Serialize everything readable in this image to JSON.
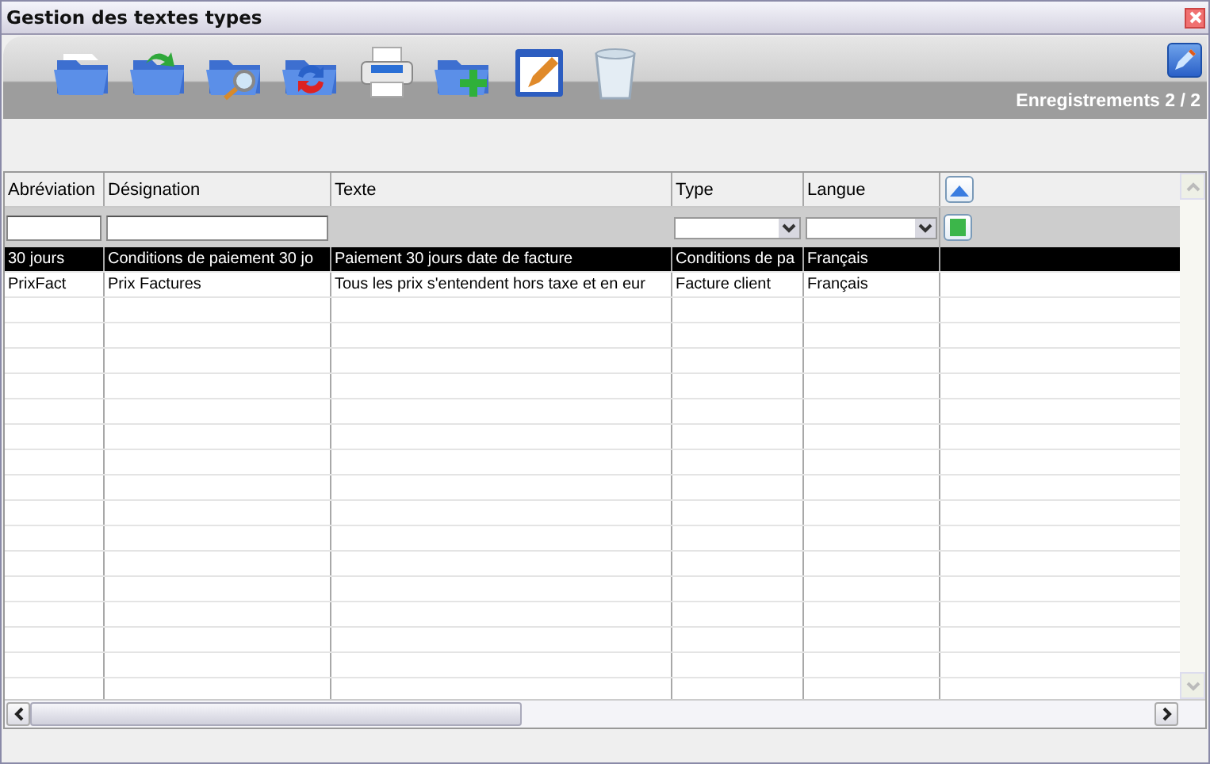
{
  "window": {
    "title": "Gestion des textes types"
  },
  "toolbar": {
    "buttons": [
      {
        "kind": "open"
      },
      {
        "kind": "import"
      },
      {
        "kind": "search"
      },
      {
        "kind": "refresh"
      },
      {
        "kind": "print"
      },
      {
        "kind": "add"
      },
      {
        "kind": "edit"
      },
      {
        "kind": "delete"
      }
    ]
  },
  "record_count": "Enregistrements 2 / 2",
  "table": {
    "columns": [
      {
        "label": "Abréviation"
      },
      {
        "label": "Désignation"
      },
      {
        "label": "Texte"
      },
      {
        "label": "Type"
      },
      {
        "label": "Langue"
      }
    ],
    "filters": [
      {
        "kind": "text"
      },
      {
        "kind": "text"
      },
      {
        "kind": "none"
      },
      {
        "kind": "select"
      },
      {
        "kind": "select"
      }
    ],
    "rows": [
      {
        "selected": true,
        "cells": [
          "30 jours",
          "Conditions de paiement 30 jo",
          "Paiement 30 jours date de facture",
          "Conditions de pa",
          "Français"
        ]
      },
      {
        "selected": false,
        "cells": [
          "PrixFact",
          "Prix Factures",
          "Tous les prix s'entendent hors taxe et en eur",
          "Facture client",
          "Français"
        ]
      }
    ]
  }
}
